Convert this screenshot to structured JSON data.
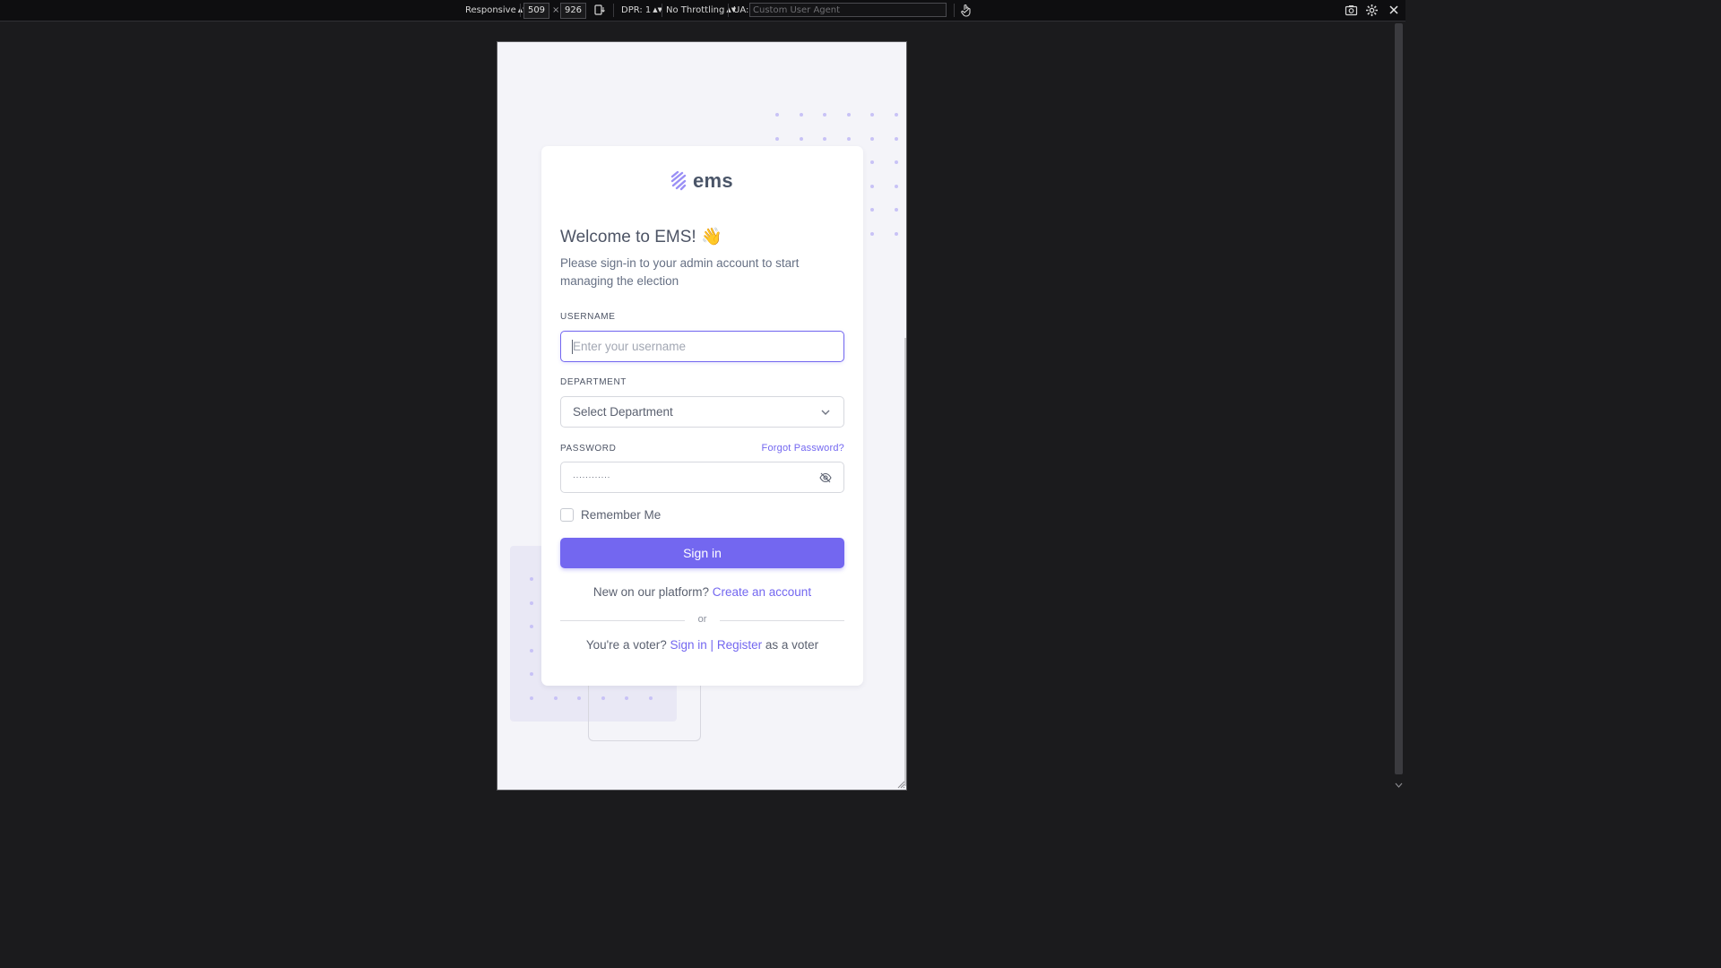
{
  "devtools": {
    "device": "Responsive",
    "width": "509",
    "times": "×",
    "height": "926",
    "dpr": "DPR: 1",
    "throttling": "No Throttling",
    "ua_label": "UA:",
    "ua_placeholder": "Custom User Agent"
  },
  "brand": {
    "name": "ems"
  },
  "login": {
    "title": "Welcome to EMS! 👋",
    "subtitle": "Please sign-in to your admin account to start managing the election",
    "username_label": "USERNAME",
    "username_placeholder": "Enter your username",
    "department_label": "DEPARTMENT",
    "department_selected": "Select Department",
    "password_label": "PASSWORD",
    "forgot_password": "Forgot Password?",
    "password_value": "············",
    "remember_me": "Remember Me",
    "sign_in_button": "Sign in",
    "new_prompt": "New on our platform?",
    "create_account": "Create an account",
    "or": "or",
    "voter_prompt": "You're a voter?",
    "voter_sign_in": "Sign in",
    "pipe": "|",
    "voter_register": "Register",
    "voter_suffix": "as a voter"
  },
  "colors": {
    "primary": "#7367f0",
    "heading": "#4d5465",
    "body_text": "#5b6170",
    "page_bg": "#f4f4f9",
    "devtools_bg": "#0e0e10"
  }
}
